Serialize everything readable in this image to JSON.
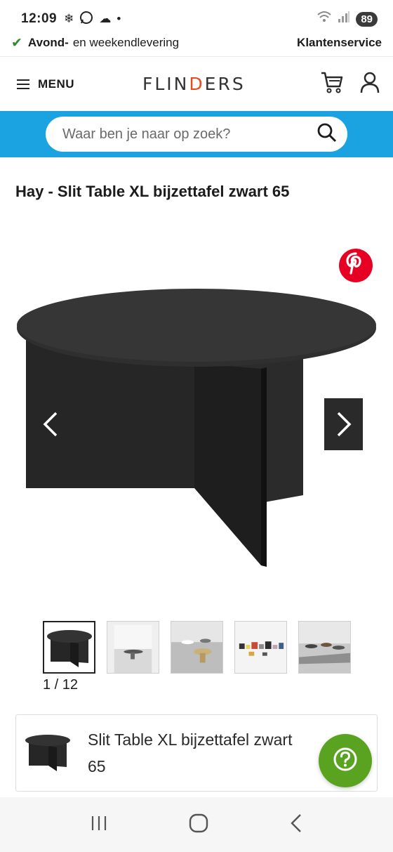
{
  "status": {
    "time": "12:09",
    "battery": "89"
  },
  "delivery": {
    "bold_text": "Avond-",
    "text": "en weekendlevering",
    "customer_service": "Klantenservice"
  },
  "header": {
    "menu_label": "MENU",
    "logo_start": "FLIN",
    "logo_d": "D",
    "logo_end": "ERS"
  },
  "search": {
    "placeholder": "Waar ben je naar op zoek?"
  },
  "product": {
    "title": "Hay - Slit Table XL bijzettafel zwart 65",
    "gallery_counter": "1 / 12",
    "sticky_name": "Slit Table XL bijzettafel zwart 65"
  },
  "icons": {
    "pinterest": "pinterest-icon",
    "help": "help-icon"
  },
  "colors": {
    "accent": "#1aa3e0",
    "help": "#5aa321",
    "pinterest": "#e60023",
    "check": "#2e8b2e"
  }
}
